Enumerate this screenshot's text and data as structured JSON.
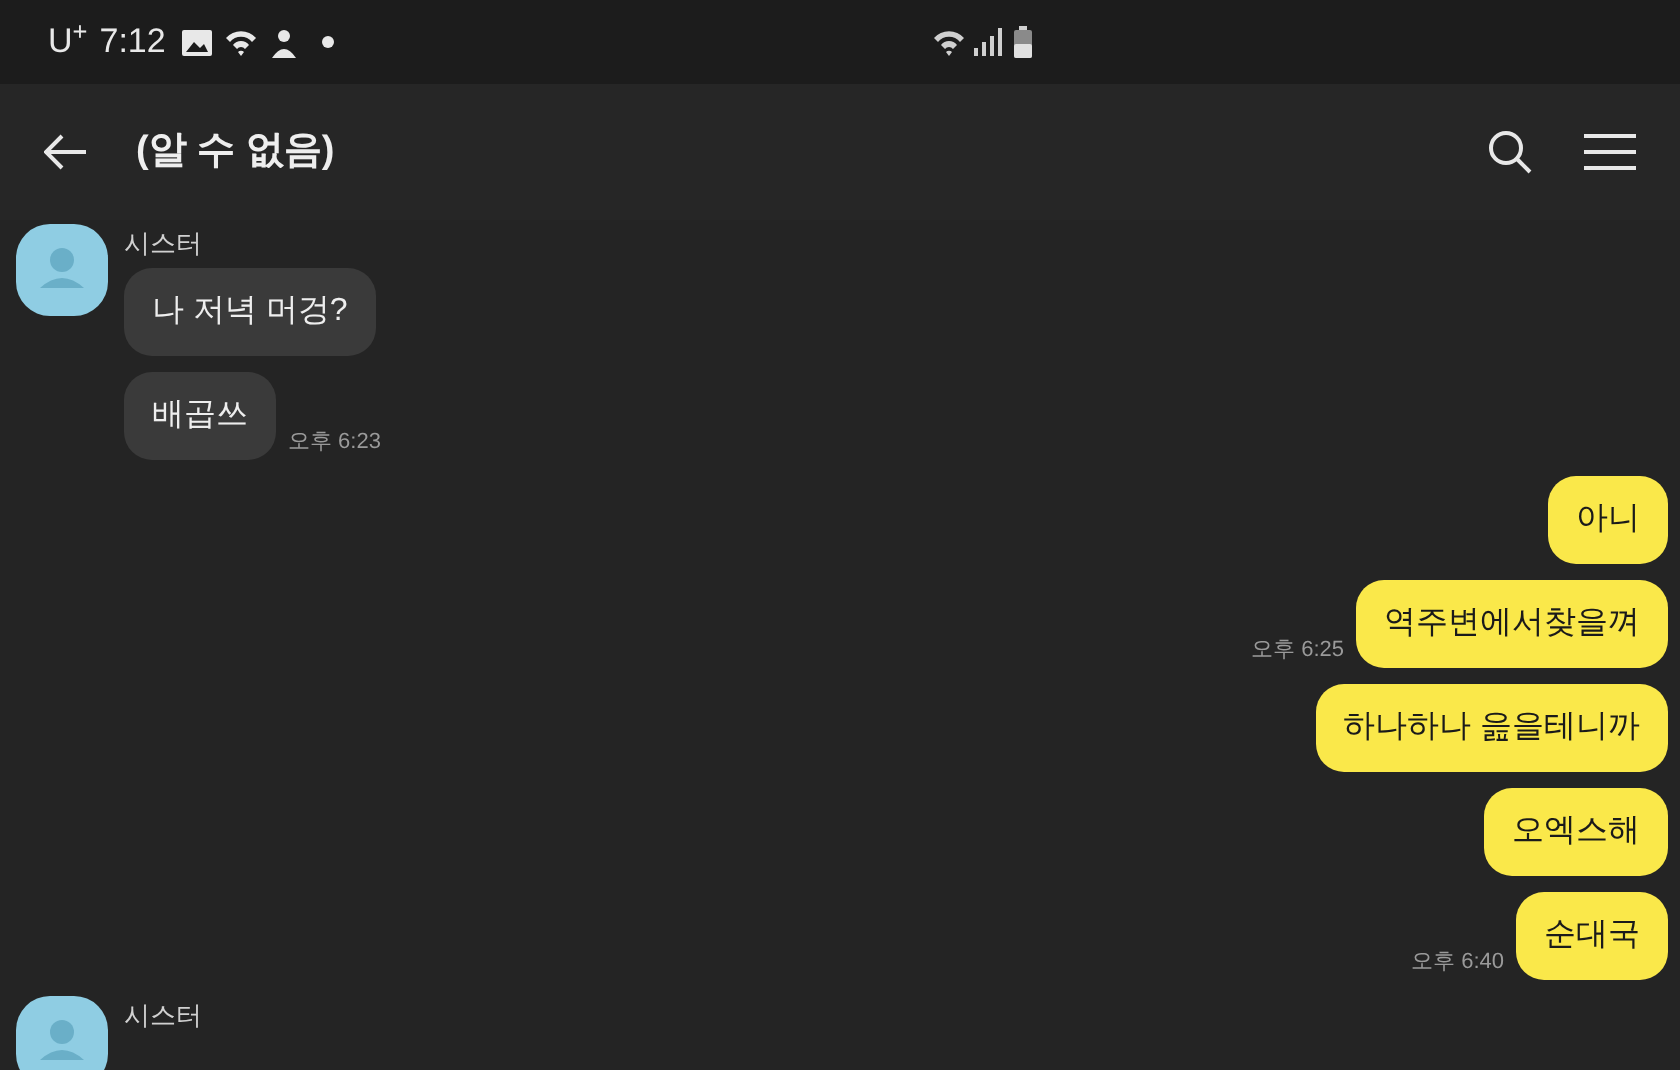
{
  "status_bar": {
    "carrier": "U$^{+}$",
    "time": "7:12"
  },
  "header": {
    "title": "(알 수 없음)"
  },
  "messages": [
    {
      "kind": "received",
      "sender": "시스터",
      "bubbles": [
        {
          "text": "나 저녁 머겅?"
        },
        {
          "text": "배곱쓰",
          "time": "오후 6:23"
        }
      ]
    },
    {
      "kind": "sent",
      "bubbles": [
        {
          "text": "아니"
        },
        {
          "text": "역주변에서찾을껴",
          "time": "오후 6:25"
        },
        {
          "text": "하나하나 읊을테니까"
        },
        {
          "text": "오엑스해"
        },
        {
          "text": "순대국",
          "time": "오후 6:40"
        }
      ]
    },
    {
      "kind": "received",
      "sender": "시스터"
    }
  ]
}
